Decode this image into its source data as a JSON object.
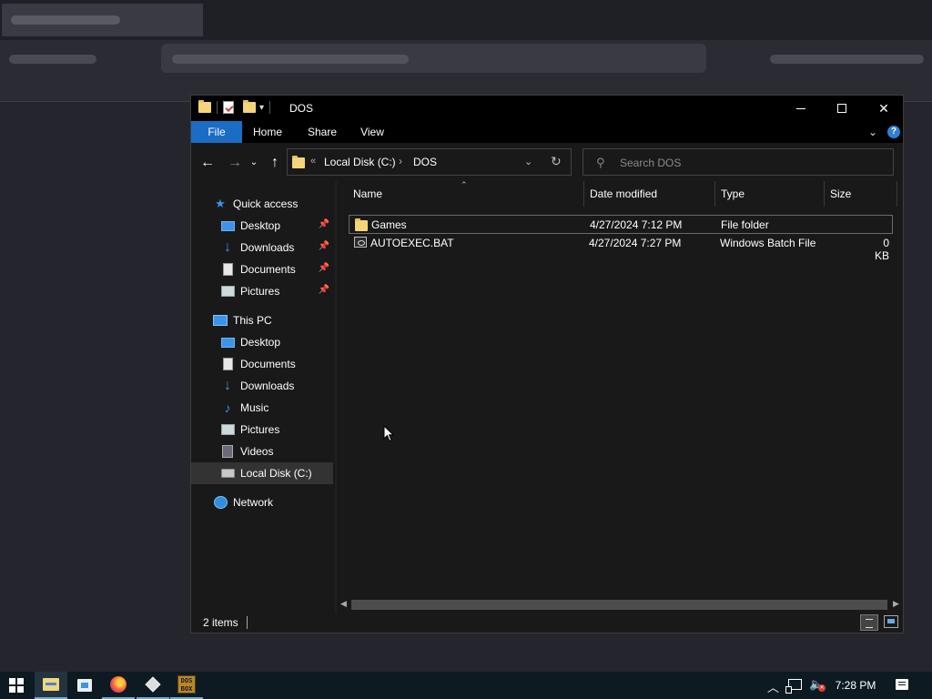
{
  "explorer": {
    "title": "DOS",
    "ribbon_tabs": [
      "File",
      "Home",
      "Share",
      "View"
    ],
    "address": {
      "root": "Local Disk (C:)",
      "current": "DOS"
    },
    "search_placeholder": "Search DOS",
    "columns": {
      "name": "Name",
      "date": "Date modified",
      "type": "Type",
      "size": "Size"
    },
    "files": [
      {
        "name": "Games",
        "date": "4/27/2024 7:12 PM",
        "type": "File folder",
        "size": "",
        "icon": "folder-icon"
      },
      {
        "name": "AUTOEXEC.BAT",
        "date": "4/27/2024 7:27 PM",
        "type": "Windows Batch File",
        "size": "0 KB",
        "icon": "batch-file-icon"
      }
    ],
    "nav": {
      "quick_access": {
        "label": "Quick access",
        "items": [
          "Desktop",
          "Downloads",
          "Documents",
          "Pictures"
        ]
      },
      "this_pc": {
        "label": "This PC",
        "items": [
          "Desktop",
          "Documents",
          "Downloads",
          "Music",
          "Pictures",
          "Videos",
          "Local Disk (C:)"
        ]
      },
      "network": "Network"
    },
    "status": {
      "item_count": "2 items"
    }
  },
  "taskbar": {
    "clock": "7:28 PM",
    "apps": [
      "start-icon",
      "file-explorer-icon",
      "store-icon",
      "firefox-icon",
      "virtualbox-icon",
      "dosbox-icon"
    ],
    "dosbox_label": "DOS BOX"
  }
}
